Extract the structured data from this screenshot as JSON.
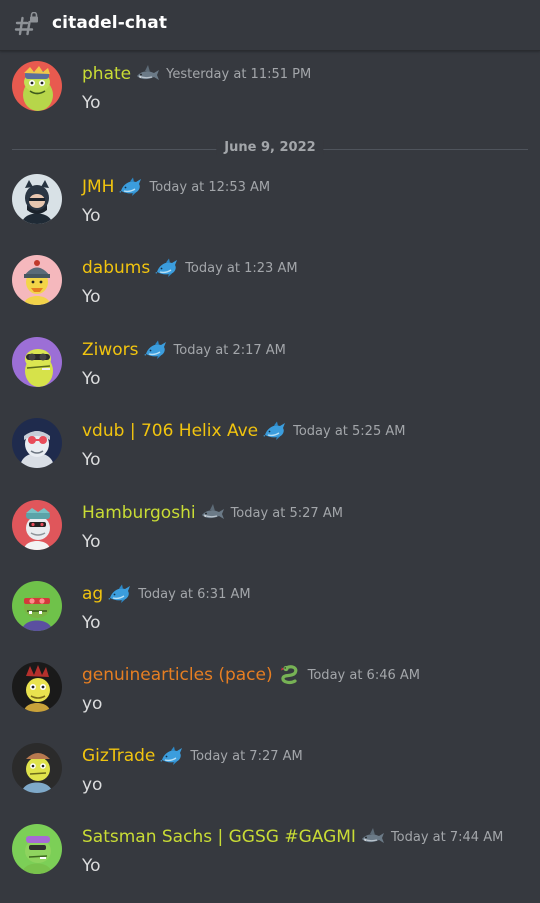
{
  "channel": {
    "name": "citadel-chat",
    "icon": "hashtag-lock-icon"
  },
  "colors": {
    "background": "#36393f",
    "username_yellow": "#f1c40f",
    "username_orange": "#e67e22",
    "username_lime": "#c9dc35",
    "timestamp": "#a3a6aa",
    "text": "#dcddde"
  },
  "divider": {
    "date": "June 9, 2022"
  },
  "messages": [
    {
      "username": "phate",
      "badge": "shark-icon",
      "timestamp": "Yesterday at 11:51 PM",
      "content": "Yo"
    },
    {
      "username": "JMH",
      "badge": "dolphin-icon",
      "timestamp": "Today at 12:53 AM",
      "content": "Yo"
    },
    {
      "username": "dabums",
      "badge": "dolphin-icon",
      "timestamp": "Today at 1:23 AM",
      "content": "Yo"
    },
    {
      "username": "Ziwors",
      "badge": "dolphin-icon",
      "timestamp": "Today at 2:17 AM",
      "content": "Yo"
    },
    {
      "username": "vdub | 706 Helix Ave",
      "badge": "dolphin-icon",
      "timestamp": "Today at 5:25 AM",
      "content": "Yo"
    },
    {
      "username": "Hamburgoshi",
      "badge": "shark-icon",
      "timestamp": "Today at 5:27 AM",
      "content": "Yo"
    },
    {
      "username": "ag",
      "badge": "dolphin-icon",
      "timestamp": "Today at 6:31 AM",
      "content": "Yo"
    },
    {
      "username": "genuinearticles (pace)",
      "badge": "snake-icon",
      "timestamp": "Today at 6:46 AM",
      "content": "yo"
    },
    {
      "username": "GizTrade",
      "badge": "dolphin-icon",
      "timestamp": "Today at 7:27 AM",
      "content": "yo"
    },
    {
      "username": "Satsman Sachs | GGSG #GAGMI",
      "badge": "shark-icon",
      "timestamp": "Today at 7:44 AM",
      "content": "Yo"
    }
  ]
}
